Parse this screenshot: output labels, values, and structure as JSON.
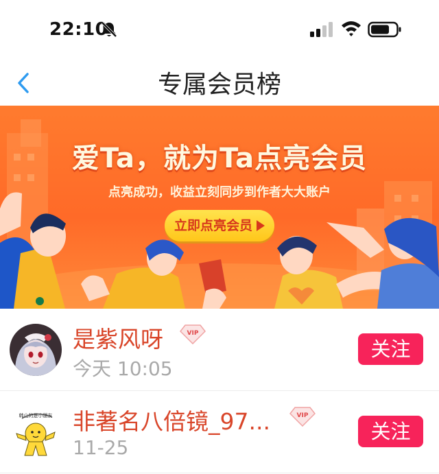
{
  "status_bar": {
    "time": "22:10"
  },
  "nav": {
    "title": "专属会员榜"
  },
  "banner": {
    "headline": "爱Ta，就为Ta点亮会员",
    "subtitle": "点亮成功，收益立刻同步到作者大大账户",
    "cta_label": "立即点亮会员"
  },
  "members": [
    {
      "name": "是紫风呀",
      "time": "今天 10:05",
      "badge": "VIP",
      "follow_label": "关注"
    },
    {
      "name": "非著名八倍镜_97...",
      "time": "11-25",
      "badge": "VIP",
      "follow_label": "关注"
    }
  ],
  "avatar2_caption": "韩山的是小朋友"
}
